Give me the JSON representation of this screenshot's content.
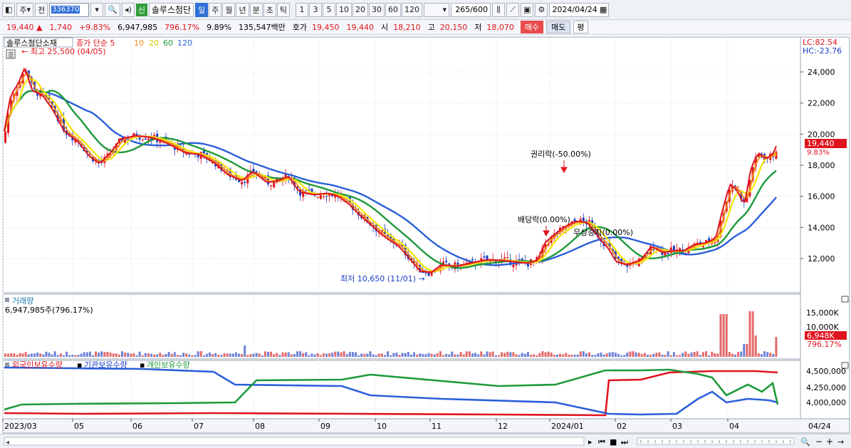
{
  "toolbar": {
    "period_label": "주",
    "prev_label": "전",
    "code": "336370",
    "new_badge": "신",
    "stock_name": "솔루스첨단",
    "timeframes": [
      "일",
      "주",
      "월",
      "년",
      "분",
      "초",
      "틱"
    ],
    "intervals": [
      "1",
      "3",
      "5",
      "10",
      "20",
      "30",
      "60",
      "120"
    ],
    "count": "265",
    "total": "/600",
    "date": "2024/04/24"
  },
  "quote": {
    "price": "19,440",
    "change": "1,740",
    "change_pct": "+9.83%",
    "volume": "6,947,985",
    "volume_ratio": "796.17%",
    "rate": "9.89%",
    "amount": "135,547백만",
    "bid_label": "호가",
    "bid": "19,450",
    "ask": "19,440",
    "open_label": "시",
    "open": "18,210",
    "high_label": "고",
    "high": "20,150",
    "low_label": "저",
    "low": "18,070",
    "buy_label": "매수",
    "sell_label": "매도",
    "eval_label": "평"
  },
  "price_panel": {
    "legend_name": "솔루스첨단소재",
    "legend_ma": "종가 단순",
    "ma_periods": [
      "5",
      "10",
      "20",
      "60",
      "120"
    ],
    "high_note": "최고 25,500 (04/05)",
    "low_note": "최저 10,650 (11/01)",
    "event_rights": "권리락(-50.00%)",
    "event_dividend": "배당락(0.00%)",
    "event_bonus": "무상증자(0.00%)",
    "lc": "LC:82.54",
    "hc": "HC:-23.76",
    "y_ticks": [
      "24,000",
      "22,000",
      "20,000",
      "18,000",
      "16,000",
      "14,000",
      "12,000"
    ],
    "current_price": "19,440",
    "current_pct": "9.83%"
  },
  "volume_panel": {
    "title": "거래량",
    "value": "6,947,985주(796.17%)",
    "y_ticks": [
      "15,000K",
      "10,000K"
    ],
    "current": "6,948K",
    "current_pct": "796.17%"
  },
  "holding_panel": {
    "foreign": "외국인보유수량",
    "institution": "기관보유수량",
    "individual": "개인보유수량",
    "y_ticks": [
      "4,500,000",
      "4,250,000",
      "4,000,000"
    ]
  },
  "x_axis": [
    "2023/03",
    "05",
    "06",
    "07",
    "08",
    "09",
    "10",
    "11",
    "12",
    "2024/01",
    "02",
    "03",
    "04",
    "04/24"
  ],
  "colors": {
    "up": "#e0141e",
    "down": "#1a3cc8",
    "ma5": "#e0141e",
    "ma10": "#f28c1e",
    "ma20": "#f5e614",
    "ma60": "#1e9a3a",
    "ma120": "#2b5fd9"
  }
}
